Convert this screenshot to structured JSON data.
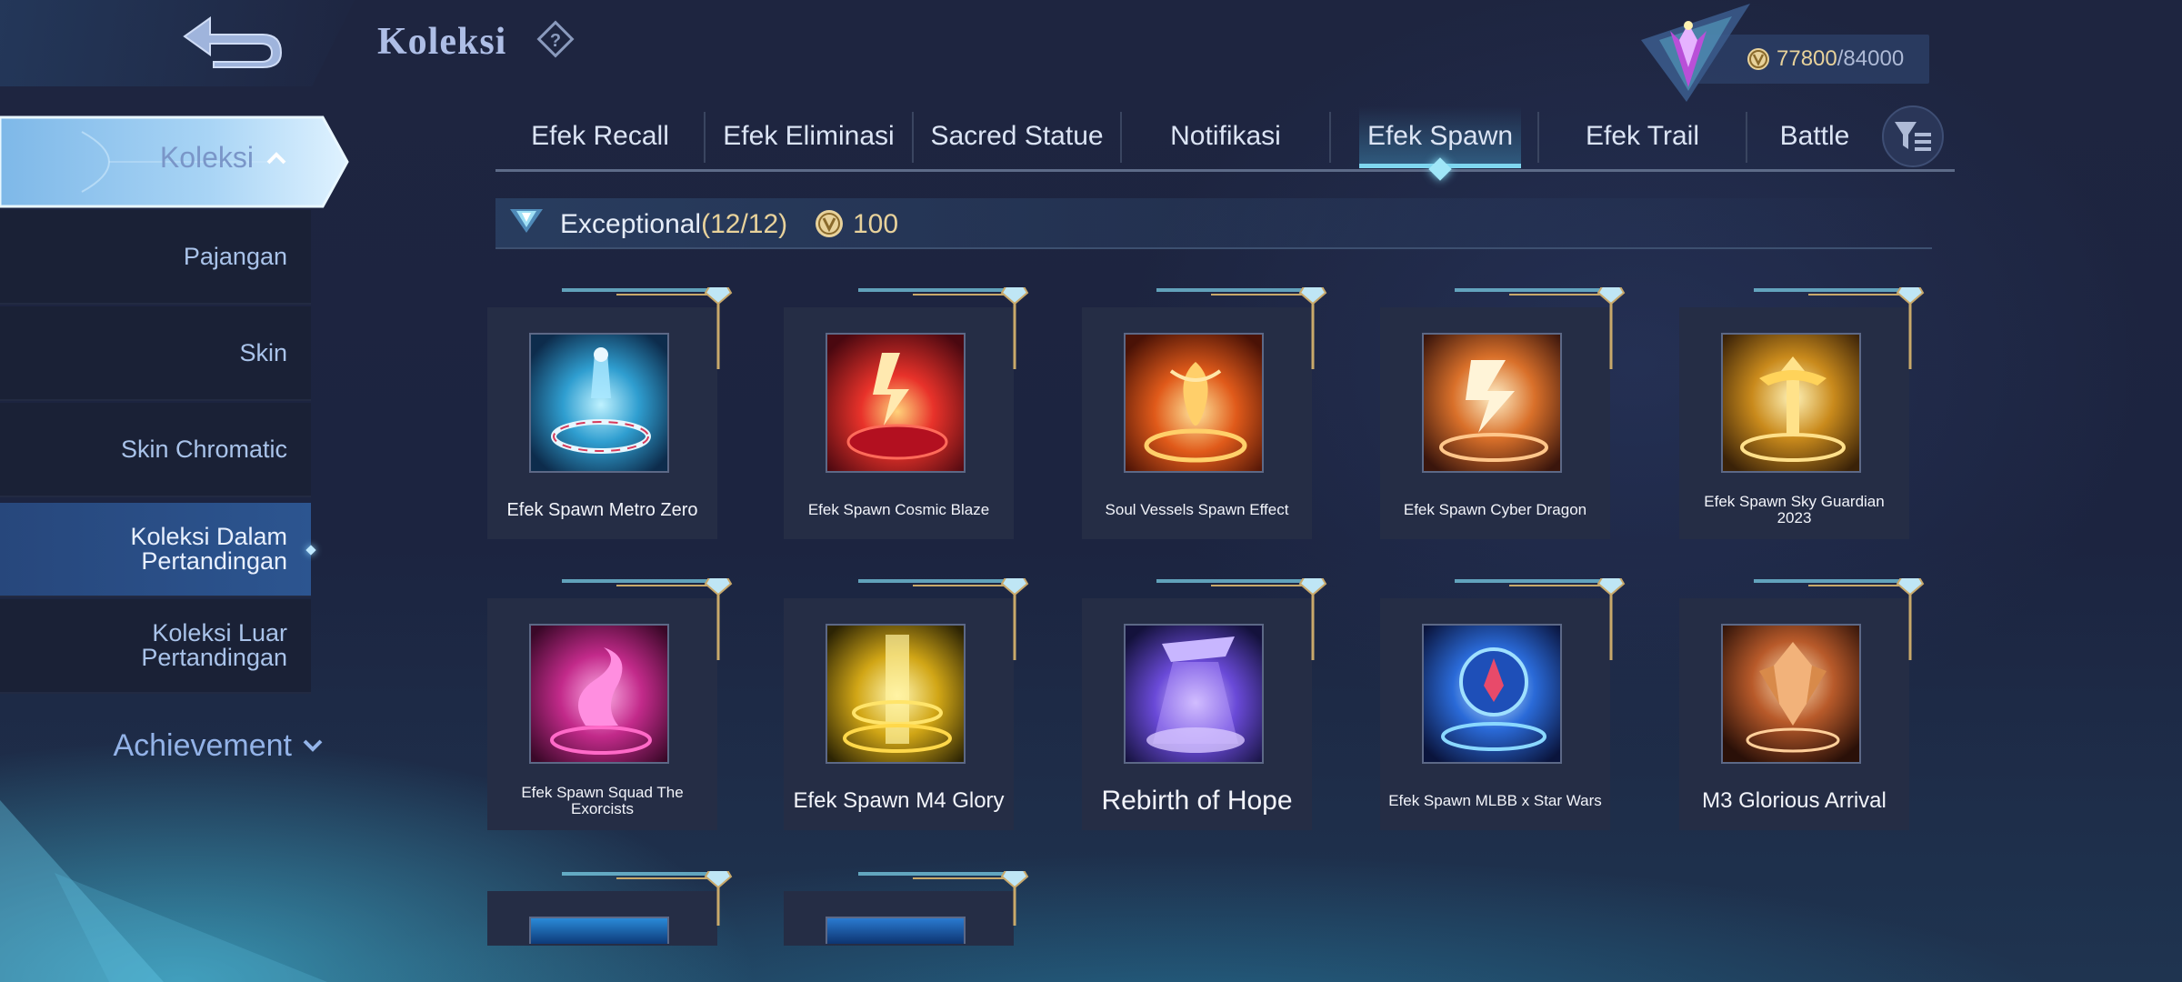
{
  "header": {
    "title": "Koleksi",
    "points_current": "77800",
    "points_separator": "/",
    "points_max": "84000"
  },
  "sidebar": {
    "main_label": "Koleksi",
    "items": [
      {
        "label": "Pajangan"
      },
      {
        "label": "Skin"
      },
      {
        "label": "Skin Chromatic"
      },
      {
        "label": "Koleksi Dalam Pertandingan"
      },
      {
        "label": "Koleksi Luar Pertandingan"
      }
    ],
    "achievement_label": "Achievement"
  },
  "tabs": [
    {
      "label": "Efek Recall"
    },
    {
      "label": "Efek Eliminasi"
    },
    {
      "label": "Sacred Statue"
    },
    {
      "label": "Notifikasi"
    },
    {
      "label": "Efek Spawn"
    },
    {
      "label": "Efek Trail"
    },
    {
      "label": "Battle"
    }
  ],
  "active_tab": "Efek Spawn",
  "section": {
    "title": "Exceptional",
    "count": "(12/12)",
    "points": "100"
  },
  "items": [
    {
      "name": "Efek Spawn Metro Zero"
    },
    {
      "name": "Efek Spawn Cosmic Blaze"
    },
    {
      "name": "Soul Vessels Spawn Effect"
    },
    {
      "name": "Efek Spawn Cyber Dragon"
    },
    {
      "name": "Efek Spawn Sky Guardian 2023"
    },
    {
      "name": "Efek Spawn Squad The Exorcists"
    },
    {
      "name": "Efek Spawn M4 Glory"
    },
    {
      "name": "Rebirth of Hope"
    },
    {
      "name": "Efek Spawn MLBB x Star Wars"
    },
    {
      "name": "M3 Glorious Arrival"
    }
  ],
  "colors": {
    "accent_gold": "#e8d29b",
    "accent_cyan": "#7fd7ef",
    "sidebar_active": "#2c5590"
  }
}
